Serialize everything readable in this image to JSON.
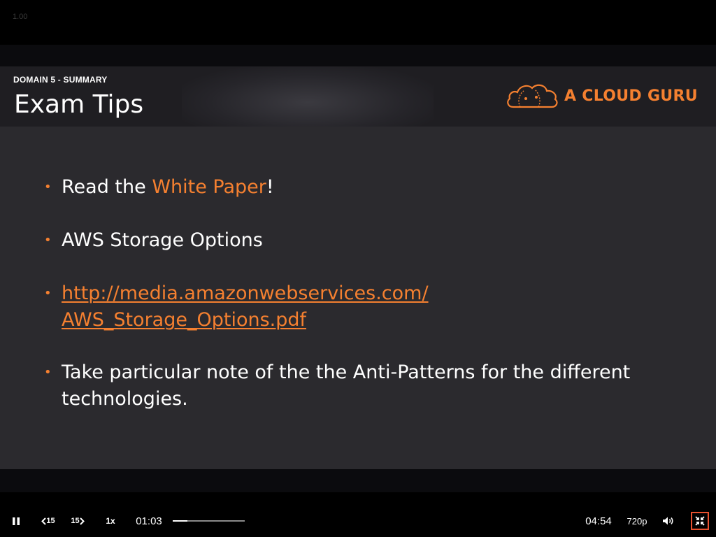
{
  "viewer": {
    "zoom_label": "1.00"
  },
  "slide": {
    "domain_label": "DOMAIN 5 - SUMMARY",
    "title": "Exam Tips",
    "logo_text": "A CLOUD GURU",
    "bullets": [
      {
        "pre": "Read the ",
        "accent": "White Paper",
        "post": "!"
      },
      {
        "text": "AWS Storage Options"
      },
      {
        "link_line1": "http://media.amazonwebservices.com/",
        "link_line2": "AWS_Storage_Options.pdf"
      },
      {
        "line1": "Take particular note of the the Anti-Patterns for the different",
        "line2": "technologies."
      }
    ]
  },
  "player": {
    "rewind_label": "15",
    "forward_label": "15",
    "speed_label": "1x",
    "current_time": "01:03",
    "total_time": "04:54",
    "quality_label": "720p",
    "progress_fraction": 0.2,
    "icons": [
      "pause-icon",
      "rewind-15-icon",
      "forward-15-icon",
      "volume-icon",
      "exit-fullscreen-icon"
    ]
  },
  "colors": {
    "accent": "#f58030",
    "slide_bg": "#2b2a2e",
    "fullscreen_border": "#e8512f"
  }
}
